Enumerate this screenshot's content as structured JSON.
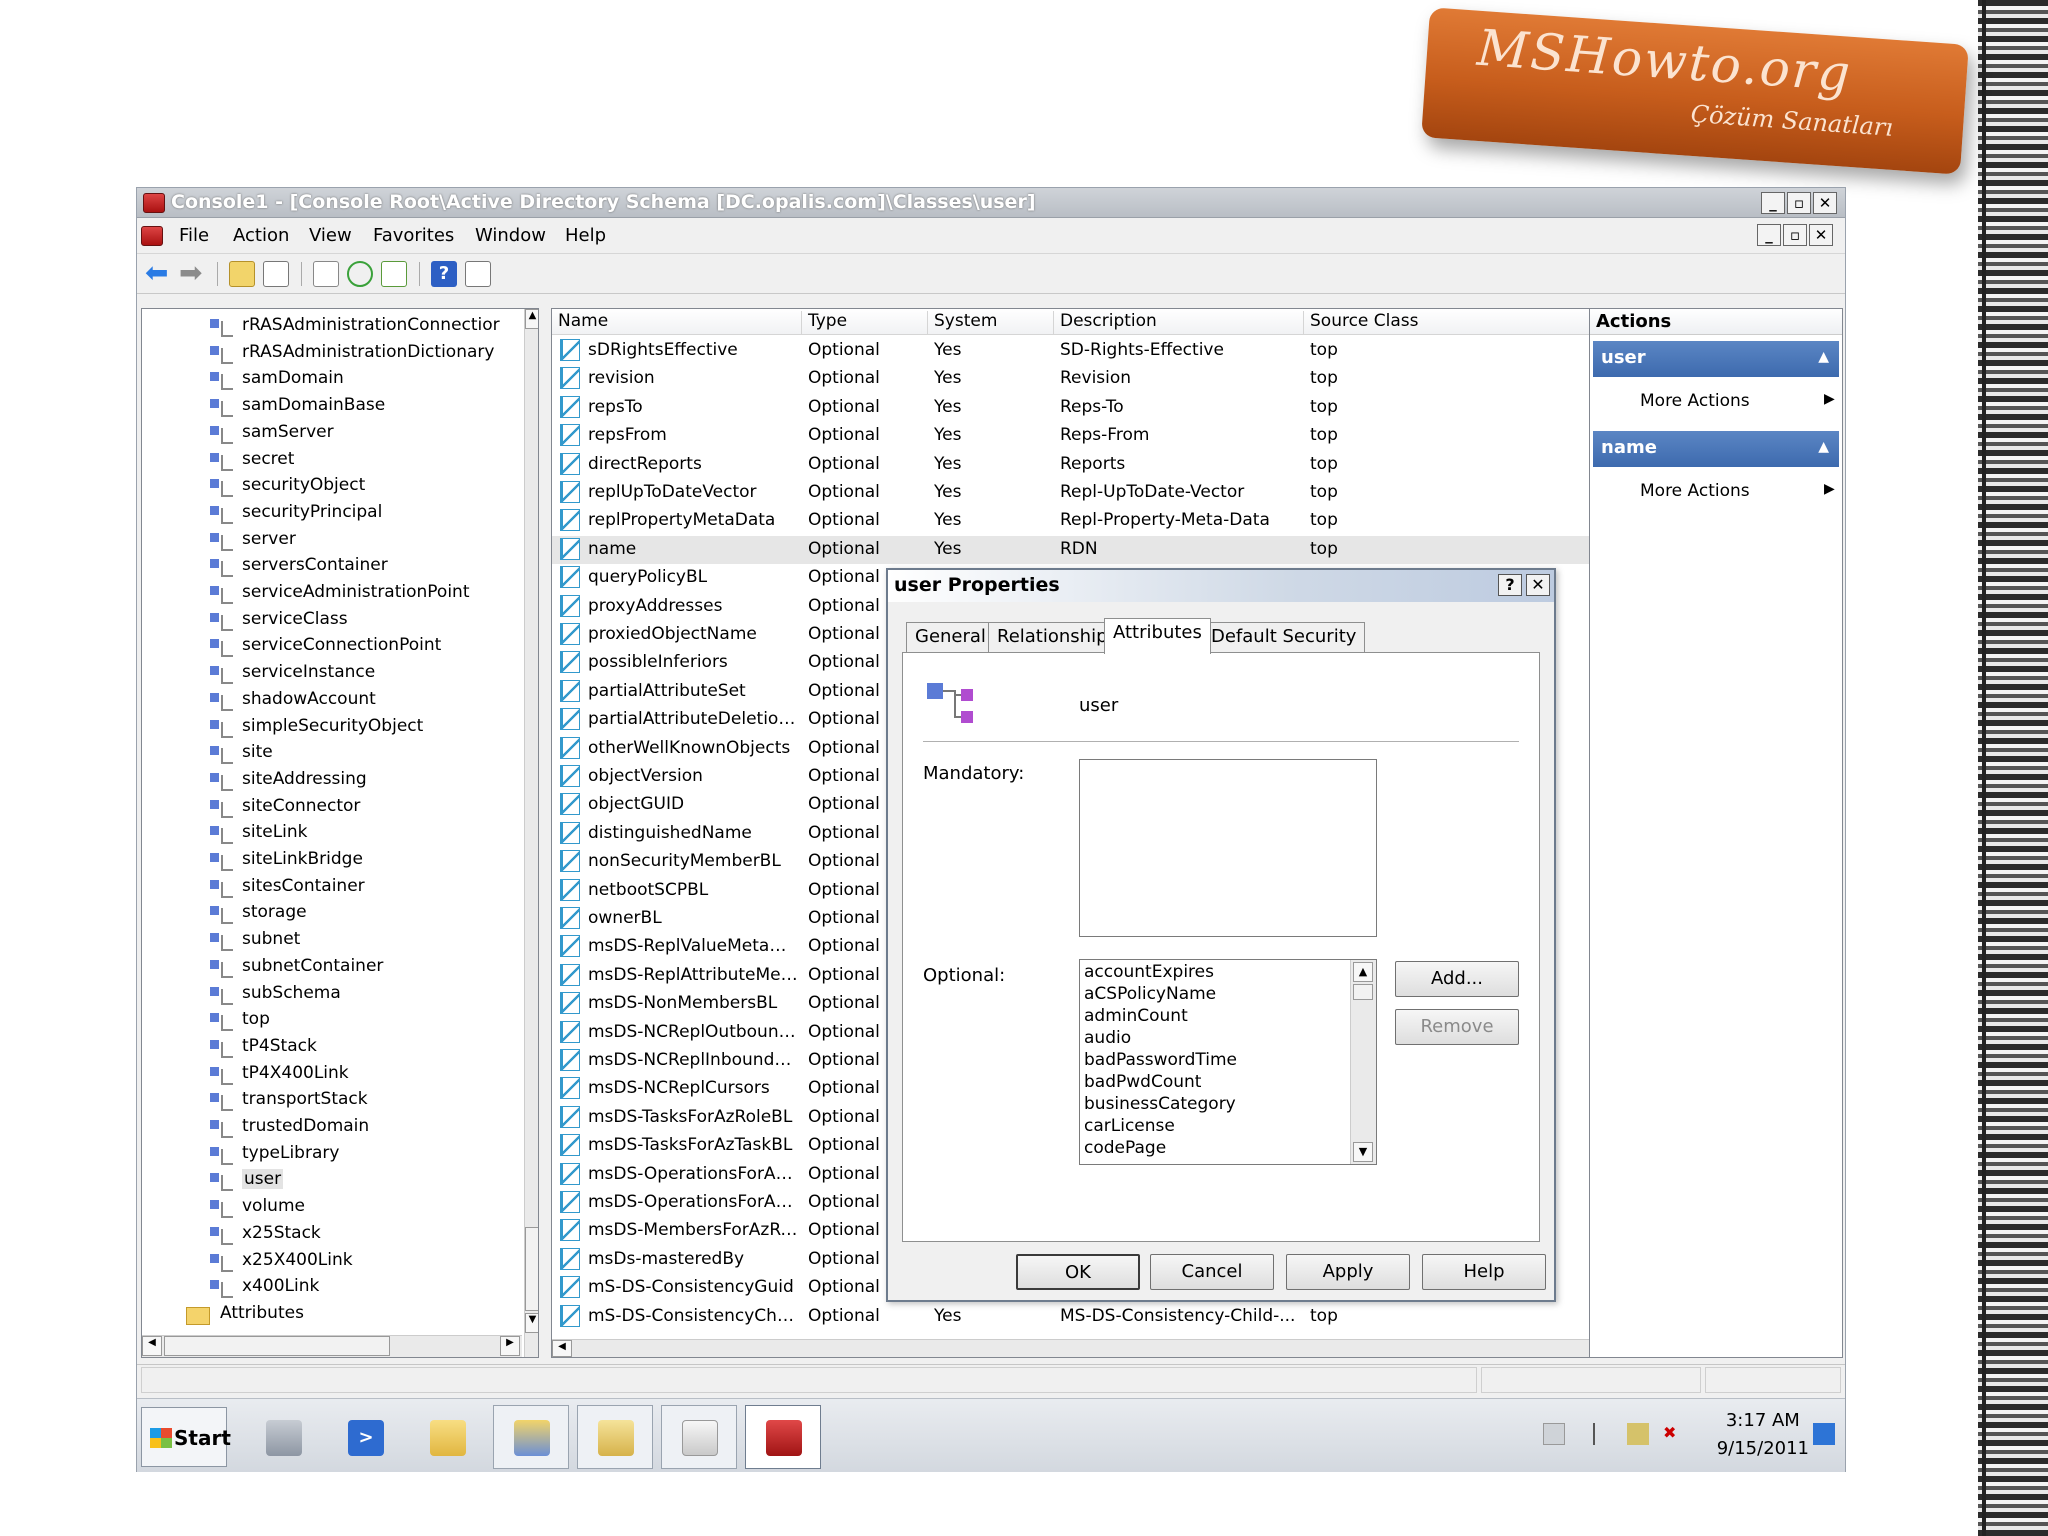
{
  "logo": {
    "title": "MSHowto.org",
    "subtitle": "Çözüm Sanatları"
  },
  "window": {
    "title": "Console1 - [Console Root\\Active Directory Schema [DC.opalis.com]\\Classes\\user]"
  },
  "menu": [
    "File",
    "Action",
    "View",
    "Favorites",
    "Window",
    "Help"
  ],
  "tree": {
    "items": [
      "rRASAdministrationConnectior",
      "rRASAdministrationDictionary",
      "samDomain",
      "samDomainBase",
      "samServer",
      "secret",
      "securityObject",
      "securityPrincipal",
      "server",
      "serversContainer",
      "serviceAdministrationPoint",
      "serviceClass",
      "serviceConnectionPoint",
      "serviceInstance",
      "shadowAccount",
      "simpleSecurityObject",
      "site",
      "siteAddressing",
      "siteConnector",
      "siteLink",
      "siteLinkBridge",
      "sitesContainer",
      "storage",
      "subnet",
      "subnetContainer",
      "subSchema",
      "top",
      "tP4Stack",
      "tP4X400Link",
      "transportStack",
      "trustedDomain",
      "typeLibrary",
      "user",
      "volume",
      "x25Stack",
      "x25X400Link",
      "x400Link"
    ],
    "selected": "user",
    "attributes_folder": "Attributes"
  },
  "list": {
    "columns": [
      "Name",
      "Type",
      "System",
      "Description",
      "Source Class"
    ],
    "rows": [
      [
        "sDRightsEffective",
        "Optional",
        "Yes",
        "SD-Rights-Effective",
        "top"
      ],
      [
        "revision",
        "Optional",
        "Yes",
        "Revision",
        "top"
      ],
      [
        "repsTo",
        "Optional",
        "Yes",
        "Reps-To",
        "top"
      ],
      [
        "repsFrom",
        "Optional",
        "Yes",
        "Reps-From",
        "top"
      ],
      [
        "directReports",
        "Optional",
        "Yes",
        "Reports",
        "top"
      ],
      [
        "replUpToDateVector",
        "Optional",
        "Yes",
        "Repl-UpToDate-Vector",
        "top"
      ],
      [
        "replPropertyMetaData",
        "Optional",
        "Yes",
        "Repl-Property-Meta-Data",
        "top"
      ],
      [
        "name",
        "Optional",
        "Yes",
        "RDN",
        "top"
      ],
      [
        "queryPolicyBL",
        "Optional",
        "",
        "",
        ""
      ],
      [
        "proxyAddresses",
        "Optional",
        "",
        "",
        ""
      ],
      [
        "proxiedObjectName",
        "Optional",
        "",
        "",
        ""
      ],
      [
        "possibleInferiors",
        "Optional",
        "",
        "",
        ""
      ],
      [
        "partialAttributeSet",
        "Optional",
        "",
        "",
        ""
      ],
      [
        "partialAttributeDeletion...",
        "Optional",
        "",
        "",
        ""
      ],
      [
        "otherWellKnownObjects",
        "Optional",
        "",
        "",
        ""
      ],
      [
        "objectVersion",
        "Optional",
        "",
        "",
        ""
      ],
      [
        "objectGUID",
        "Optional",
        "",
        "",
        ""
      ],
      [
        "distinguishedName",
        "Optional",
        "",
        "",
        ""
      ],
      [
        "nonSecurityMemberBL",
        "Optional",
        "",
        "",
        ""
      ],
      [
        "netbootSCPBL",
        "Optional",
        "",
        "",
        ""
      ],
      [
        "ownerBL",
        "Optional",
        "",
        "",
        ""
      ],
      [
        "msDS-ReplValueMetaData",
        "Optional",
        "",
        "",
        ""
      ],
      [
        "msDS-ReplAttributeMet...",
        "Optional",
        "",
        "",
        ""
      ],
      [
        "msDS-NonMembersBL",
        "Optional",
        "",
        "",
        ""
      ],
      [
        "msDS-NCReplOutbound...",
        "Optional",
        "",
        "",
        ""
      ],
      [
        "msDS-NCReplInboundN...",
        "Optional",
        "",
        "",
        ""
      ],
      [
        "msDS-NCReplCursors",
        "Optional",
        "",
        "",
        ""
      ],
      [
        "msDS-TasksForAzRoleBL",
        "Optional",
        "",
        "",
        ""
      ],
      [
        "msDS-TasksForAzTaskBL",
        "Optional",
        "",
        "",
        ""
      ],
      [
        "msDS-OperationsForAz...",
        "Optional",
        "",
        "",
        ""
      ],
      [
        "msDS-OperationsForAz...",
        "Optional",
        "",
        "",
        ""
      ],
      [
        "msDS-MembersForAzRo...",
        "Optional",
        "",
        "",
        ""
      ],
      [
        "msDs-masteredBy",
        "Optional",
        "",
        "",
        ""
      ],
      [
        "mS-DS-ConsistencyGuid",
        "Optional",
        "",
        "",
        ""
      ],
      [
        "mS-DS-ConsistencyChil...",
        "Optional",
        "Yes",
        "MS-DS-Consistency-Child-...",
        "top"
      ]
    ],
    "selected_index": 7
  },
  "actions": {
    "header": "Actions",
    "groups": [
      {
        "title": "user",
        "item": "More Actions"
      },
      {
        "title": "name",
        "item": "More Actions"
      }
    ]
  },
  "dialog": {
    "title": "user Properties",
    "help_btn": "?",
    "close_btn": "✕",
    "tabs": [
      "General",
      "Relationship",
      "Attributes",
      "Default Security"
    ],
    "active_tab": "Attributes",
    "class_name": "user",
    "mandatory_label": "Mandatory:",
    "optional_label": "Optional:",
    "optional_items": [
      "accountExpires",
      "aCSPolicyName",
      "adminCount",
      "audio",
      "badPasswordTime",
      "badPwdCount",
      "businessCategory",
      "carLicense",
      "codePage"
    ],
    "add_btn": "Add...",
    "remove_btn": "Remove",
    "ok_btn": "OK",
    "cancel_btn": "Cancel",
    "apply_btn": "Apply",
    "help_label": "Help"
  },
  "taskbar": {
    "start_label": "Start",
    "time": "3:17 AM",
    "date": "9/15/2011"
  }
}
